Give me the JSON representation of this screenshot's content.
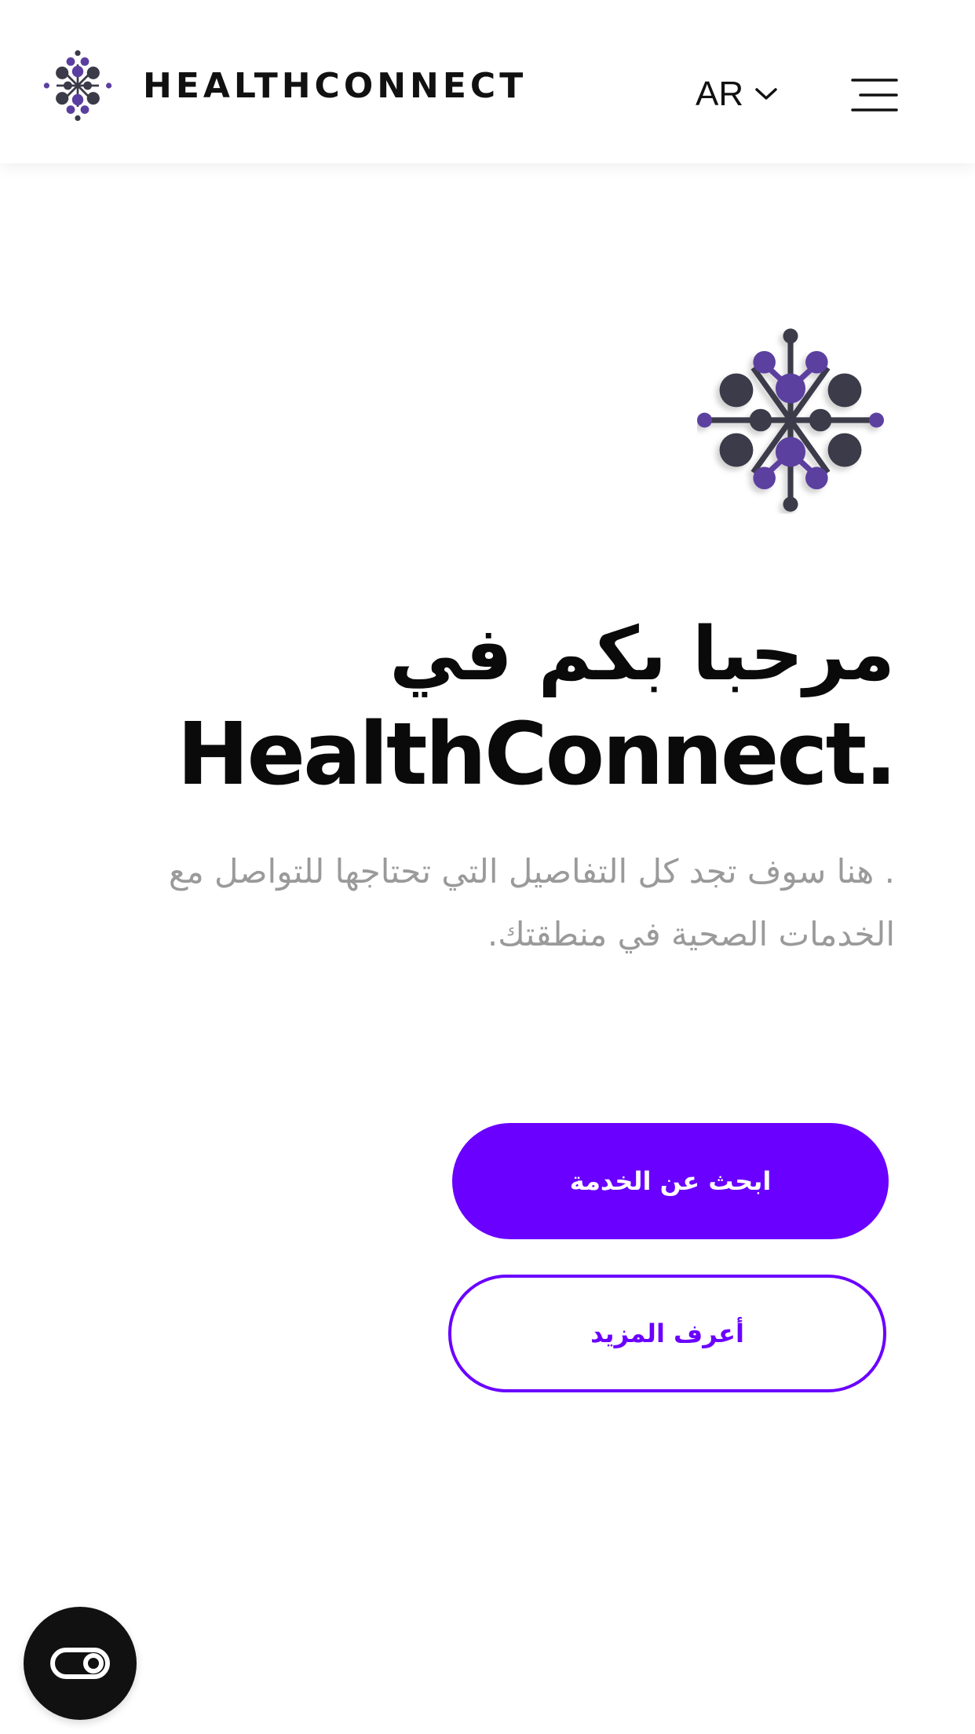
{
  "header": {
    "brand_name": "HEALTHCONNECT",
    "language": "AR",
    "logo_icon": "molecule-logo-icon",
    "chevron_icon": "chevron-down-icon",
    "menu_icon": "hamburger-menu-icon"
  },
  "hero": {
    "logo_icon": "molecule-logo-icon",
    "title_ar": "مرحبا بكم في",
    "title_en": "HealthConnect.",
    "description": ". هنا سوف تجد كل التفاصيل التي تحتاجها للتواصل مع الخدمات الصحية في منطقتك."
  },
  "actions": {
    "primary_label": "ابحث عن الخدمة",
    "secondary_label": "أعرف المزيد"
  },
  "floating": {
    "a11y_icon": "toggle-switch-icon"
  },
  "colors": {
    "accent": "#6a00ff",
    "logo_dark": "#3b3a48",
    "logo_purple": "#5b3fa0",
    "text_muted": "#9a9a9a"
  }
}
